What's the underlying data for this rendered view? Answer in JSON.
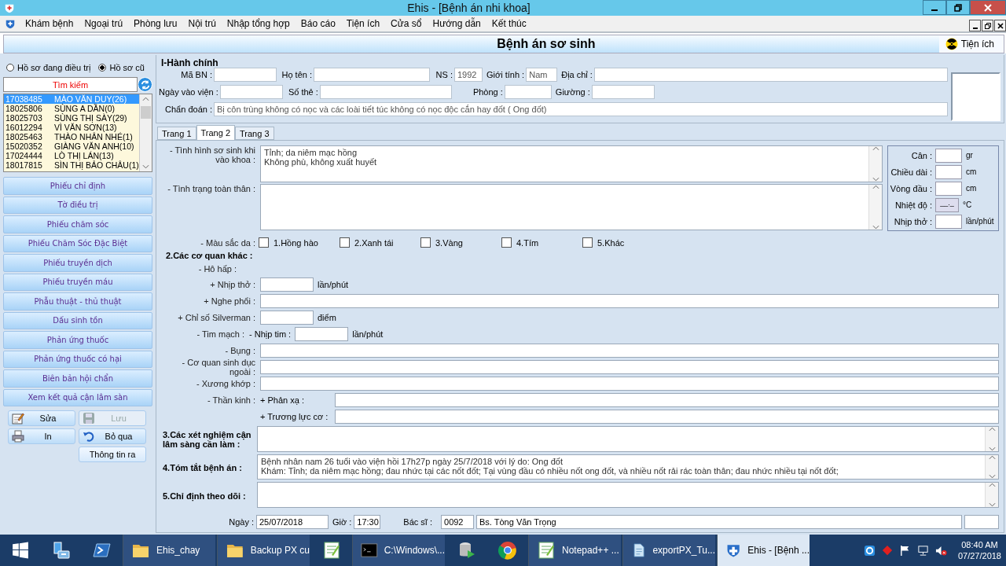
{
  "window": {
    "title": "Ehis - [Bệnh án nhi khoa]"
  },
  "menu": [
    "Khám bệnh",
    "Ngoại trú",
    "Phòng lưu",
    "Nội trú",
    "Nhập tổng hợp",
    "Báo cáo",
    "Tiện ích",
    "Cửa sổ",
    "Hướng dẫn",
    "Kết thúc"
  ],
  "form_title": "Bệnh án sơ sinh",
  "utility_button": "Tiện ích",
  "sidebar": {
    "radios": [
      {
        "label": "Hồ sơ đang điều trị",
        "selected": false
      },
      {
        "label": "Hồ sơ cũ",
        "selected": true
      }
    ],
    "search_placeholder": "Tìm kiếm",
    "patients": [
      {
        "id": "17038485",
        "name": "MÀO VĂN DUY(26)",
        "selected": true
      },
      {
        "id": "18025806",
        "name": "SÙNG A DẦN(0)",
        "selected": false
      },
      {
        "id": "18025703",
        "name": "SÙNG THỊ SÀY(29)",
        "selected": false
      },
      {
        "id": "16012294",
        "name": "VÌ VĂN SƠN(13)",
        "selected": false
      },
      {
        "id": "18025463",
        "name": "THÀO NHÂN NHÉ(1)",
        "selected": false
      },
      {
        "id": "15020352",
        "name": "GIÀNG VĂN ANH(10)",
        "selected": false
      },
      {
        "id": "17024444",
        "name": "LÒ THỊ LÁN(13)",
        "selected": false
      },
      {
        "id": "18017815",
        "name": "SÌN THỊ BẢO CHÂU(1)",
        "selected": false
      }
    ],
    "nav_buttons": [
      "Phiếu chỉ định",
      "Tờ điều trị",
      "Phiếu chăm sóc",
      "Phiếu Chăm Sóc Đặc Biệt",
      "Phiếu truyền dịch",
      "Phiếu truyền máu",
      "Phẫu thuật - thủ thuật",
      "Dấu sinh tồn",
      "Phản ứng thuốc",
      "Phản ứng thuốc có hại",
      "Biên bản hội chẩn",
      "Xem kết quả cận lâm sàn"
    ],
    "actions": [
      {
        "label": "Sửa",
        "kind": "edit",
        "disabled": false
      },
      {
        "label": "Lưu",
        "kind": "save",
        "disabled": true
      },
      {
        "label": "In",
        "kind": "print",
        "disabled": false
      },
      {
        "label": "Bỏ qua",
        "kind": "undo",
        "disabled": false
      },
      {
        "label": "Thông tin ra",
        "kind": "plain",
        "disabled": false
      }
    ]
  },
  "admin": {
    "title": "I-Hành chính",
    "lines": [
      {
        "fields": [
          {
            "label": "Mã BN :"
          },
          {
            "label": "Họ tên :"
          },
          {
            "label": "NS :",
            "value": "1992"
          },
          {
            "label": "Giới tính :",
            "value": "Nam"
          },
          {
            "label": "Địa chỉ :"
          }
        ]
      },
      {
        "fields": [
          {
            "label": "Ngày vào viện :"
          },
          {
            "label": "Số thẻ :"
          },
          {
            "label": "Phòng :"
          },
          {
            "label": "Giường :"
          }
        ]
      },
      {
        "fields": [
          {
            "label": "Chẩn đoán :",
            "value": "Bị côn trùng không có nọc và các loài tiết túc không có nọc độc cắn hay đốt ( Ong đốt)"
          }
        ]
      }
    ]
  },
  "tabs": [
    {
      "label": "Trang 1",
      "selected": false
    },
    {
      "label": "Trang 2",
      "selected": true
    },
    {
      "label": "Trang 3",
      "selected": false
    }
  ],
  "page2": {
    "general": [
      {
        "label": "- Tình hình sơ sinh khi vào khoa :",
        "value": "Tỉnh; da niêm mạc hồng\nKhông phù, không xuất huyết"
      },
      {
        "label": "- Tình trạng toàn thân :"
      }
    ],
    "vitals": [
      {
        "label": "Cân :",
        "unit": "gr"
      },
      {
        "label": "Chiều dài :",
        "unit": "cm"
      },
      {
        "label": "Vòng đầu :",
        "unit": "cm"
      },
      {
        "label": "Nhiệt độ :",
        "value": "__._",
        "unit": "°C"
      },
      {
        "label": "Nhịp thở :",
        "unit": "lần/phút"
      }
    ],
    "skin": {
      "label": "- Màu sắc da :",
      "options": [
        {
          "label": "1.Hồng hào",
          "checked": false
        },
        {
          "label": "2.Xanh tái",
          "checked": false
        },
        {
          "label": "3.Vàng",
          "checked": false
        },
        {
          "label": "4.Tím",
          "checked": false
        },
        {
          "label": "5.Khác",
          "checked": false
        }
      ]
    },
    "organs_heading": "2.Các cơ quan khác :",
    "organ_rows": [
      {
        "kind": "label",
        "label": "- Hô hấp :"
      },
      {
        "kind": "short",
        "label": "+ Nhịp thở :",
        "unit": "lần/phút"
      },
      {
        "kind": "wide",
        "label": "+ Nghe phổi :"
      },
      {
        "kind": "short",
        "label": "+ Chỉ số Silverman :",
        "unit": "điểm"
      },
      {
        "kind": "sub_short",
        "label": "- Tim mạch :",
        "sublabel": "- Nhịp tim :",
        "unit": "lần/phút"
      },
      {
        "kind": "wide",
        "label": "- Bụng :"
      },
      {
        "kind": "wide",
        "label": "- Cơ quan sinh dục ngoài :"
      },
      {
        "kind": "wide",
        "label": "- Xương khớp :"
      },
      {
        "kind": "sub_wide",
        "label": "- Thần kinh :",
        "sublabel": "+ Phản xạ :"
      },
      {
        "kind": "sub_wide",
        "sublabel": "+ Trương lực cơ :"
      }
    ],
    "summaries": [
      {
        "label": "3.Các xét nghiệm cận lâm sàng cần làm :"
      },
      {
        "label": "4.Tóm tắt bệnh án :",
        "value": "Bệnh nhân nam 26 tuổi vào viện hồi 17h27p ngày 25/7/2018 với lý do: Ong đốt\nKhám: Tỉnh; da niêm mạc hồng; đau nhức tại các nốt đốt; Tại vùng đầu có nhiều nốt ong đốt, và nhiều nốt rải rác toàn thân; đau nhức nhiều tại nốt đốt;"
      },
      {
        "label": "5.Chỉ định theo dõi :"
      }
    ],
    "footer": {
      "date_label": "Ngày :",
      "date": "25/07/2018",
      "time_label": "Giờ :",
      "time": "17:30",
      "doctor_label": "Bác sĩ :",
      "doctor_code": "0092",
      "doctor_name": "Bs. Tòng Văn Trọng"
    }
  },
  "taskbar": {
    "items": [
      {
        "kind": "start"
      },
      {
        "kind": "server"
      },
      {
        "kind": "shell"
      },
      {
        "kind": "folder",
        "label": "Ehis_chay",
        "selected": false
      },
      {
        "kind": "folder",
        "label": "Backup PX cu",
        "selected": false
      },
      {
        "kind": "notepad",
        "selected": false
      },
      {
        "kind": "terminal",
        "label": "C:\\Windows\\...",
        "selected": false
      },
      {
        "kind": "database"
      },
      {
        "kind": "browser"
      },
      {
        "kind": "notepad",
        "label": "Notepad++ ...",
        "selected": false
      },
      {
        "kind": "file",
        "label": "exportPX_Tu...",
        "selected": false
      },
      {
        "kind": "app",
        "label": "Ehis - [Bệnh ...",
        "selected": true
      }
    ],
    "time": "08:40 AM",
    "date": "07/27/2018"
  }
}
